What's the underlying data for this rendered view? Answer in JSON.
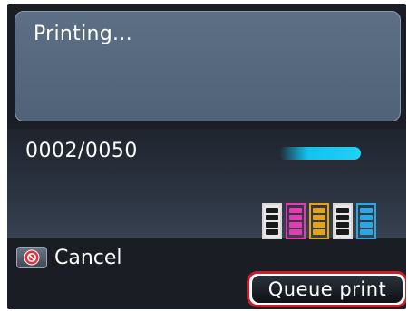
{
  "screen": {
    "status_message": "Printing...",
    "page_counter": "0002/0050",
    "progress_fraction": 0.9,
    "progress_color": "#12c3ee"
  },
  "ink_tanks": [
    {
      "name": "black-ink",
      "color": "#1a1a1a"
    },
    {
      "name": "magenta-ink",
      "color": "#e83ab0"
    },
    {
      "name": "yellow-ink",
      "color": "#e6a31a"
    },
    {
      "name": "photo-black-ink",
      "color": "#1a1a1a"
    },
    {
      "name": "cyan-ink",
      "color": "#2aa8e6"
    }
  ],
  "actions": {
    "cancel_label": "Cancel",
    "cancel_icon": "stop-icon",
    "queue_label": "Queue print"
  },
  "colors": {
    "highlight_border": "#c8202a"
  }
}
